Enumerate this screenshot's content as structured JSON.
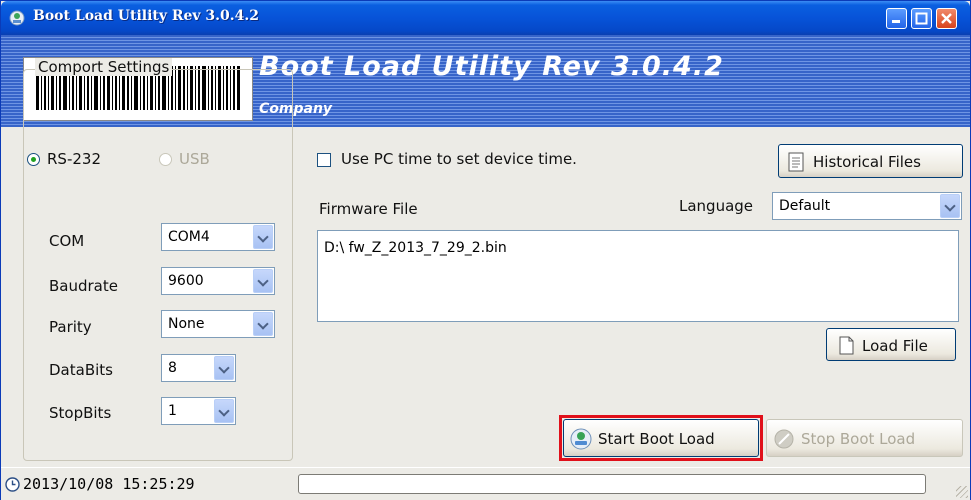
{
  "window": {
    "title": "Boot Load Utility Rev 3.0.4.2"
  },
  "banner": {
    "title": "Boot Load Utility Rev 3.0.4.2",
    "subtitle": "Company"
  },
  "interface": {
    "rs232_label": "RS-232",
    "rs232_selected": true,
    "usb_label": "USB",
    "usb_enabled": false
  },
  "comport": {
    "group_title": "Comport Settings",
    "com_label": "COM",
    "com_value": "COM4",
    "baud_label": "Baudrate",
    "baud_value": "9600",
    "parity_label": "Parity",
    "parity_value": "None",
    "databits_label": "DataBits",
    "databits_value": "8",
    "stopbits_label": "StopBits",
    "stopbits_value": "1"
  },
  "options": {
    "use_pc_time_label": "Use PC time to set device time.",
    "use_pc_time_checked": false
  },
  "historical_button": "Historical Files",
  "firmware": {
    "label": "Firmware File",
    "path": "D:\\ fw_Z_2013_7_29_2.bin"
  },
  "language": {
    "label": "Language",
    "value": "Default"
  },
  "load_file_button": "Load File",
  "start_button": "Start Boot Load",
  "stop_button": "Stop Boot Load",
  "status": {
    "datetime": "2013/10/08 15:25:29"
  },
  "colors": {
    "titlebar": "#0753d8",
    "banner": "#3764c9",
    "highlight": "#e0101a",
    "panel": "#ecebe6"
  }
}
